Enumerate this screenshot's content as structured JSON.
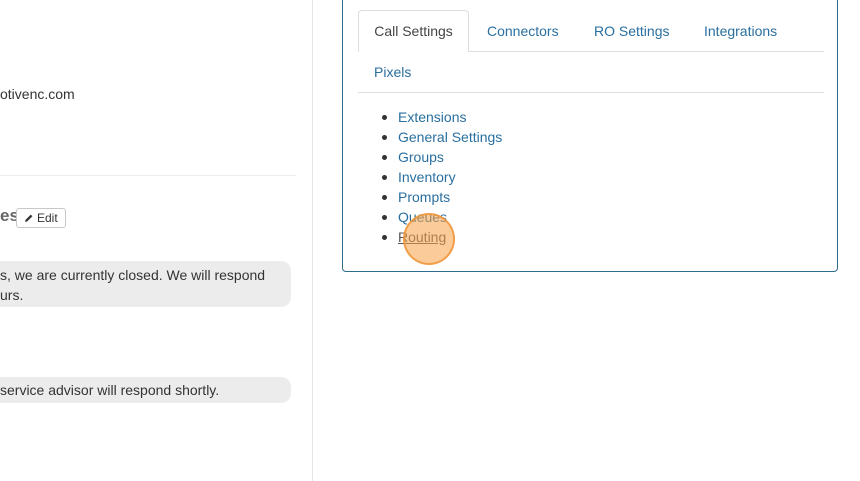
{
  "left": {
    "email_fragment": "otivenc.com",
    "section_heading_fragment": "es",
    "edit_button": {
      "label": "Edit",
      "icon": "pencil-icon"
    },
    "messages": [
      {
        "lines": [
          "s, we are currently closed. We will respond",
          "urs."
        ]
      },
      {
        "lines": [
          "service advisor will respond shortly."
        ]
      }
    ]
  },
  "panel": {
    "tabs": [
      {
        "label": "Call Settings",
        "active": true
      },
      {
        "label": "Connectors",
        "active": false
      },
      {
        "label": "RO Settings",
        "active": false
      },
      {
        "label": "Integrations",
        "active": false
      },
      {
        "label": "Pixels",
        "active": false
      }
    ],
    "links": [
      {
        "label": "Extensions"
      },
      {
        "label": "General Settings"
      },
      {
        "label": "Groups"
      },
      {
        "label": "Inventory"
      },
      {
        "label": "Prompts"
      },
      {
        "label": "Queues"
      },
      {
        "label": "Routing",
        "hovered": true
      }
    ]
  },
  "colors": {
    "link": "#2a6fa0",
    "panel_border": "#2e6b8c",
    "click_marker": "#f7a046"
  }
}
